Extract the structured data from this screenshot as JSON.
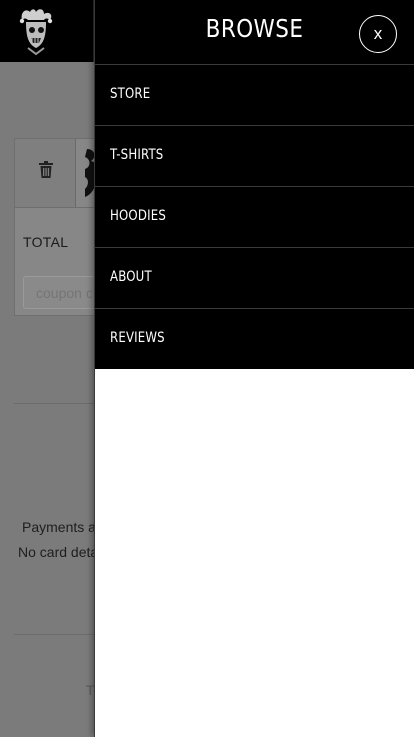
{
  "header": {
    "logo_icon": "jester-skull-logo-icon"
  },
  "cart": {
    "remove_icon": "trash-icon",
    "product_image": "product-thumbnail",
    "total_label": "TOTAL",
    "coupon_placeholder": "coupon c"
  },
  "payment": {
    "payments_text": "Payments a",
    "card_details_text": "No card deta"
  },
  "footer": {
    "text": "T"
  },
  "drawer": {
    "title": "BROWSE",
    "close_label": "x",
    "items": [
      {
        "label": "STORE"
      },
      {
        "label": "T-SHIRTS"
      },
      {
        "label": "HOODIES"
      },
      {
        "label": "ABOUT"
      },
      {
        "label": "REVIEWS"
      }
    ]
  },
  "colors": {
    "header_bg": "#000000",
    "drawer_bg": "#ffffff",
    "overlay": "#7b7b7b"
  }
}
